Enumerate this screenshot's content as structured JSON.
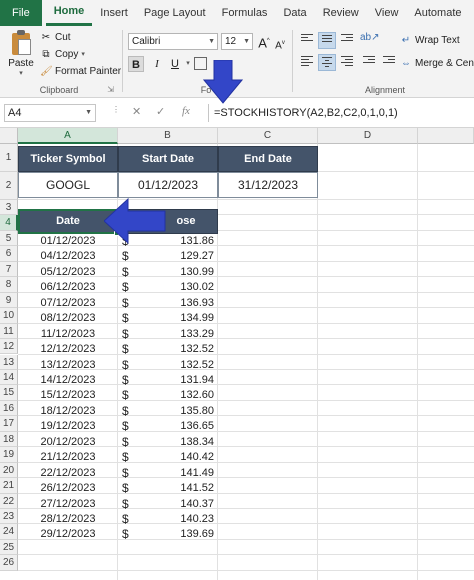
{
  "ribbon": {
    "tabs": [
      "File",
      "Home",
      "Insert",
      "Page Layout",
      "Formulas",
      "Data",
      "Review",
      "View",
      "Automate"
    ],
    "active_tab": "Home",
    "clipboard": {
      "paste_label": "Paste",
      "cut_label": "Cut",
      "copy_label": "Copy",
      "format_painter_label": "Format Painter",
      "group_label": "Clipboard"
    },
    "font": {
      "name": "Calibri",
      "size": "12",
      "bold": "B",
      "italic": "I",
      "underline": "U",
      "grow": "A",
      "shrink": "A",
      "group_label": "Fo"
    },
    "alignment": {
      "wrap_text_label": "Wrap Text",
      "merge_center_label": "Merge & Cen",
      "group_label": "Alignment"
    }
  },
  "formula_bar": {
    "name_box": "A4",
    "cancel": "✕",
    "enter": "✓",
    "fx": "fx",
    "formula": "=STOCKHISTORY(A2,B2,C2,0,1,0,1)"
  },
  "columns": [
    "A",
    "B",
    "C",
    "D"
  ],
  "rows": [
    "1",
    "2",
    "3",
    "4",
    "5",
    "6",
    "7",
    "8",
    "9",
    "10",
    "11",
    "12",
    "13",
    "14",
    "15",
    "16",
    "17",
    "18",
    "19",
    "20",
    "21",
    "22",
    "23",
    "24",
    "25",
    "26"
  ],
  "sheet": {
    "params_headers": [
      "Ticker Symbol",
      "Start Date",
      "End Date"
    ],
    "params_values": [
      "GOOGL",
      "01/12/2023",
      "31/12/2023"
    ],
    "table_headers": [
      "Date",
      "ose"
    ],
    "currency_symbol": "$",
    "data": [
      {
        "date": "01/12/2023",
        "close": "131.86"
      },
      {
        "date": "04/12/2023",
        "close": "129.27"
      },
      {
        "date": "05/12/2023",
        "close": "130.99"
      },
      {
        "date": "06/12/2023",
        "close": "130.02"
      },
      {
        "date": "07/12/2023",
        "close": "136.93"
      },
      {
        "date": "08/12/2023",
        "close": "134.99"
      },
      {
        "date": "11/12/2023",
        "close": "133.29"
      },
      {
        "date": "12/12/2023",
        "close": "132.52"
      },
      {
        "date": "13/12/2023",
        "close": "132.52"
      },
      {
        "date": "14/12/2023",
        "close": "131.94"
      },
      {
        "date": "15/12/2023",
        "close": "132.60"
      },
      {
        "date": "18/12/2023",
        "close": "135.80"
      },
      {
        "date": "19/12/2023",
        "close": "136.65"
      },
      {
        "date": "20/12/2023",
        "close": "138.34"
      },
      {
        "date": "21/12/2023",
        "close": "140.42"
      },
      {
        "date": "22/12/2023",
        "close": "141.49"
      },
      {
        "date": "26/12/2023",
        "close": "141.52"
      },
      {
        "date": "27/12/2023",
        "close": "140.37"
      },
      {
        "date": "28/12/2023",
        "close": "140.23"
      },
      {
        "date": "29/12/2023",
        "close": "139.69"
      }
    ]
  },
  "colors": {
    "excel_green": "#217346",
    "header_fill": "#44546a",
    "arrow_blue": "#3346c8"
  }
}
